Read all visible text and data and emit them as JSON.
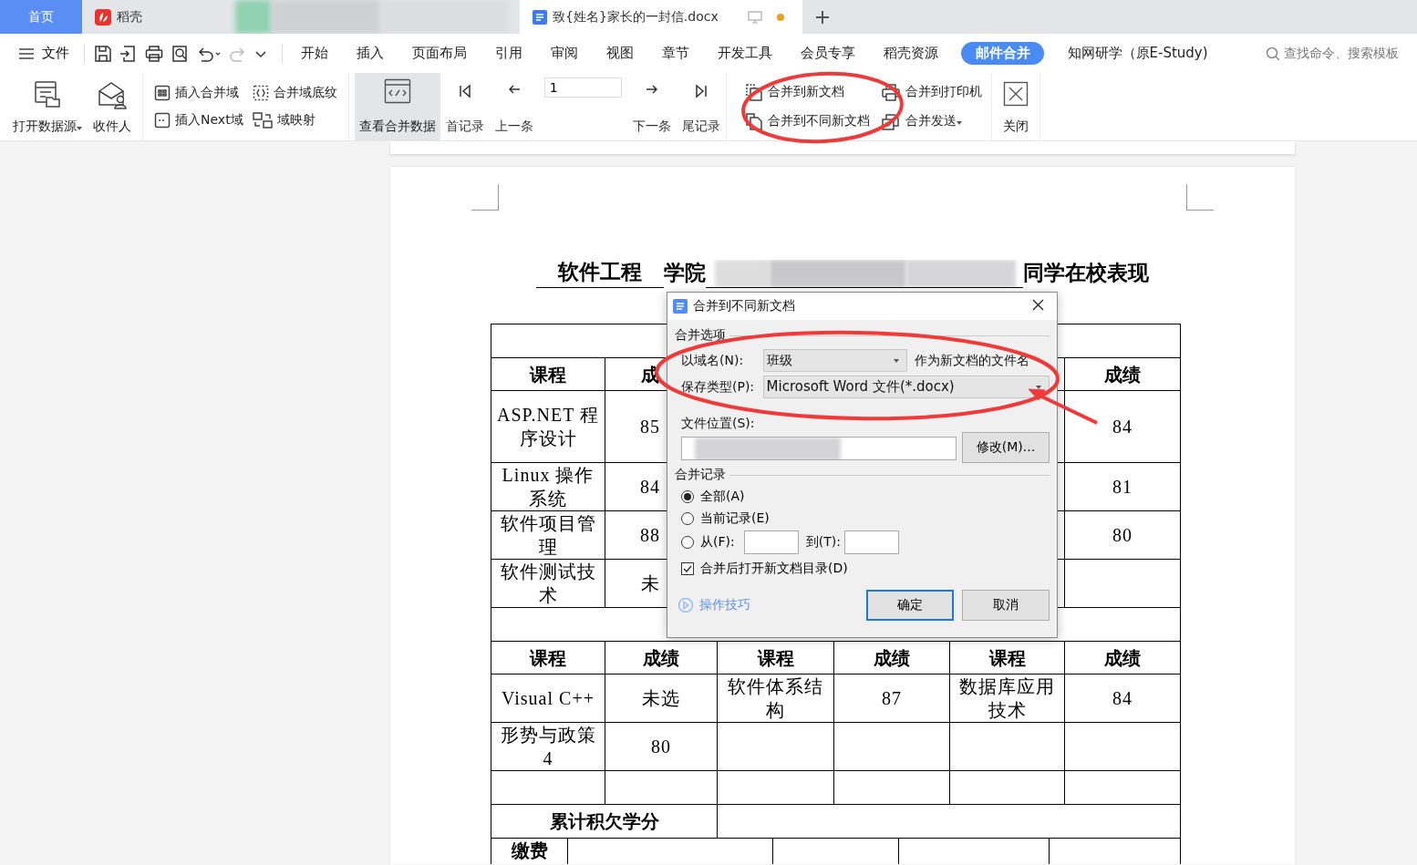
{
  "tabs": [
    {
      "kind": "home",
      "label": "首页",
      "selected": false
    },
    {
      "kind": "docer",
      "label": "稻壳",
      "selected": false
    },
    {
      "kind": "document",
      "label": "致{姓名}家长的一封信.docx",
      "selected": true,
      "unsaved": true
    }
  ],
  "menu_bar": {
    "file_label": "文件",
    "quick_access": [
      {
        "kind": "save",
        "disabled": false
      },
      {
        "kind": "export",
        "disabled": false
      },
      {
        "kind": "print",
        "disabled": false
      },
      {
        "kind": "preview",
        "disabled": false
      },
      {
        "kind": "undo",
        "disabled": false
      },
      {
        "kind": "redo",
        "disabled": true
      },
      {
        "kind": "more",
        "disabled": false
      }
    ],
    "items": [
      {
        "label": "开始",
        "selected": false
      },
      {
        "label": "插入",
        "selected": false
      },
      {
        "label": "页面布局",
        "selected": false
      },
      {
        "label": "引用",
        "selected": false
      },
      {
        "label": "审阅",
        "selected": false
      },
      {
        "label": "视图",
        "selected": false
      },
      {
        "label": "章节",
        "selected": false
      },
      {
        "label": "开发工具",
        "selected": false
      },
      {
        "label": "会员专享",
        "selected": false
      },
      {
        "label": "稻壳资源",
        "selected": false
      },
      {
        "label": "邮件合并",
        "selected": true
      },
      {
        "label": "知网研学（原E-Study)",
        "selected": false
      }
    ],
    "search_placeholder": "查找命令、搜索模板"
  },
  "ribbon": {
    "source_buttons": [
      {
        "kind": "data-source",
        "label": "打开数据源",
        "has_menu": true
      },
      {
        "kind": "recipients",
        "label": "收件人",
        "has_menu": false
      }
    ],
    "field_buttons": [
      {
        "kind": "insert-field",
        "label": "插入合并域"
      },
      {
        "kind": "shading",
        "label": "合并域底纹"
      },
      {
        "kind": "next-field",
        "label": "插入Next域"
      },
      {
        "kind": "mapping",
        "label": "域映射"
      }
    ],
    "view_merged": {
      "label": "查看合并数据",
      "pressed": true
    },
    "navigation": [
      {
        "kind": "first",
        "label": "首记录"
      },
      {
        "kind": "prev",
        "label": "上一条"
      },
      {
        "kind": "next",
        "label": "下一条"
      },
      {
        "kind": "last",
        "label": "尾记录"
      }
    ],
    "record_field": {
      "value": "1"
    },
    "merge_buttons": [
      {
        "kind": "new-doc",
        "label": "合并到新文档",
        "has_menu": false
      },
      {
        "kind": "printer",
        "label": "合并到打印机",
        "has_menu": false
      },
      {
        "kind": "different-docs",
        "label": "合并到不同新文档",
        "has_menu": false
      },
      {
        "kind": "send",
        "label": "合并发送",
        "has_menu": true
      }
    ],
    "close": {
      "label": "关闭"
    }
  },
  "document": {
    "title": [
      {
        "kind": "text",
        "text": "软件工程",
        "underlined": true
      },
      {
        "kind": "text",
        "text": "学院",
        "underlined": false
      },
      {
        "kind": "blank"
      },
      {
        "kind": "text",
        "text": "同学在校表现",
        "underlined": false
      }
    ],
    "rows": [
      {
        "kind": "blank"
      },
      {
        "kind": "header",
        "cells": [
          {
            "text": "课程"
          },
          {
            "text": "成",
            "partly_covered": true
          },
          {},
          {},
          {},
          {
            "text": "成绩"
          }
        ]
      },
      {
        "kind": "body",
        "cells": [
          {
            "text": "ASP.NET 程序设计"
          },
          {
            "text": "85",
            "partly_covered": true
          },
          {},
          {},
          {},
          {
            "text": "84"
          }
        ]
      },
      {
        "kind": "body",
        "cells": [
          {
            "text": "Linux 操作系统"
          },
          {
            "text": "84",
            "partly_covered": true
          },
          {},
          {},
          {},
          {
            "text": "81"
          }
        ]
      },
      {
        "kind": "body",
        "cells": [
          {
            "text": "软件项目管理"
          },
          {
            "text": "88",
            "partly_covered": true
          },
          {},
          {},
          {},
          {
            "text": "80"
          }
        ]
      },
      {
        "kind": "body",
        "cells": [
          {
            "text": "软件测试技术"
          },
          {
            "text": "未",
            "partly_covered": true
          },
          {},
          {},
          {},
          {}
        ]
      },
      {
        "kind": "blank"
      },
      {
        "kind": "header",
        "cells": [
          {
            "text": "课程"
          },
          {
            "text": "成绩"
          },
          {
            "text": "课程"
          },
          {
            "text": "成绩"
          },
          {
            "text": "课程"
          },
          {
            "text": "成绩"
          }
        ]
      },
      {
        "kind": "body",
        "cells": [
          {
            "text": "Visual C++"
          },
          {
            "text": "未选"
          },
          {
            "text": "软件体系结构"
          },
          {
            "text": "87"
          },
          {
            "text": "数据库应用技术"
          },
          {
            "text": "84"
          }
        ]
      },
      {
        "kind": "body",
        "cells": [
          {
            "text": "形势与政策4"
          },
          {
            "text": "80"
          },
          {},
          {},
          {},
          {}
        ]
      },
      {
        "kind": "empty"
      },
      {
        "kind": "summary",
        "cells": [
          {
            "text": "累计积欠学分"
          }
        ]
      }
    ],
    "fee_row": {
      "label": "缴费"
    }
  },
  "dialog": {
    "title": "合并到不同新文档",
    "options_heading": "合并选项",
    "field_name_label": "以域名(N):",
    "field_name_value": "班级",
    "field_name_note": "作为新文档的文件名",
    "save_type_label": "保存类型(P):",
    "save_type_value": "Microsoft Word 文件(*.docx)",
    "location_label": "文件位置(S):",
    "modify_button": "修改(M)...",
    "records_heading": "合并记录",
    "record_options": [
      {
        "kind": "plain",
        "label": "全部(A)",
        "selected": true
      },
      {
        "kind": "plain",
        "label": "当前记录(E)",
        "selected": false
      },
      {
        "kind": "range",
        "label": "从(F):",
        "selected": false
      }
    ],
    "range_to_label": "到(T):",
    "open_directory": {
      "label": "合并后打开新文档目录(D)",
      "checked": true
    },
    "tips_link": "操作技巧",
    "buttons": [
      {
        "label": "确定",
        "default": true
      },
      {
        "label": "取消",
        "default": false
      }
    ]
  }
}
